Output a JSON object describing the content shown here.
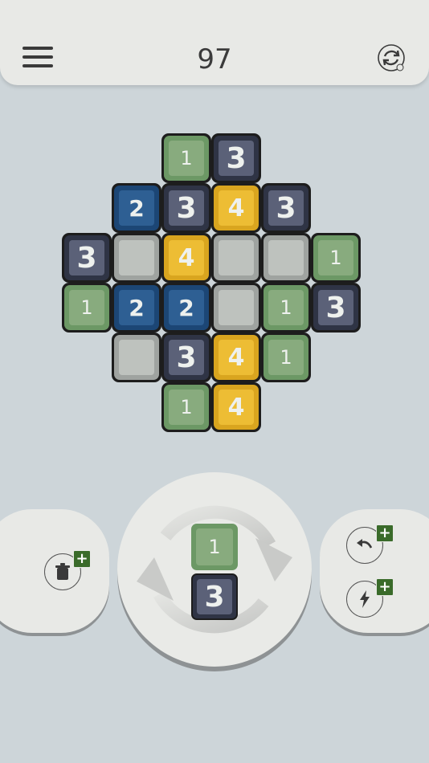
{
  "header": {
    "score": "97",
    "menu_icon": "hamburger-menu-icon",
    "refresh_icon": "refresh-ad-icon"
  },
  "colors": {
    "tile_1": "#88ab7e",
    "tile_2": "#2e5f93",
    "tile_3": "#5b6178",
    "tile_4": "#edbd34",
    "empty": "#bec2be",
    "badge": "#3a6b2a"
  },
  "board": {
    "rows": [
      [
        "1",
        "3"
      ],
      [
        "2",
        "3",
        "4",
        "3"
      ],
      [
        "3",
        "",
        "4",
        "",
        "",
        "1"
      ],
      [
        "1",
        "2",
        "2",
        "",
        "1",
        "3"
      ],
      [
        "",
        "3",
        "4",
        "1"
      ],
      [
        "1",
        "4"
      ]
    ]
  },
  "next_piece": {
    "top": "1",
    "bottom": "3"
  },
  "powerups": {
    "trash": {
      "icon": "trash-icon",
      "badge": "+"
    },
    "undo": {
      "icon": "undo-icon",
      "badge": "+"
    },
    "lightning": {
      "icon": "lightning-icon",
      "badge": "+"
    }
  }
}
